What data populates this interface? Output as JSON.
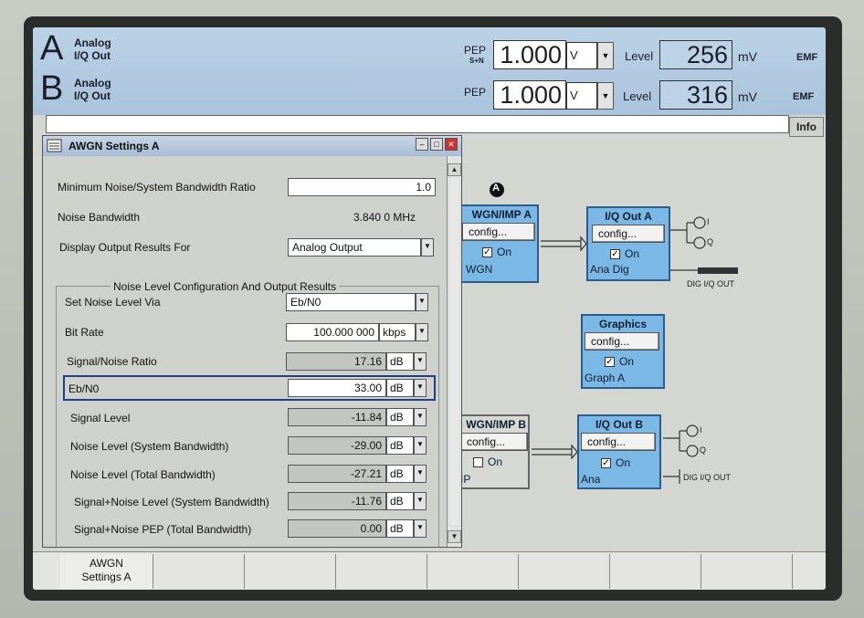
{
  "header": {
    "path_a": {
      "letter": "A",
      "line1": "Analog",
      "line2": "I/Q Out"
    },
    "path_b": {
      "letter": "B",
      "line1": "Analog",
      "line2": "I/Q Out"
    },
    "pep_a_label": "PEP",
    "pep_a_sub": "S+N",
    "pep_a_value": "1.000",
    "pep_a_unit": "V",
    "pep_b_label": "PEP",
    "pep_b_value": "1.000",
    "pep_b_unit": "V",
    "level_label": "Level",
    "level_a_value": "256",
    "level_a_unit": "mV",
    "level_b_value": "316",
    "level_b_unit": "mV",
    "emf": "EMF",
    "info_button": "Info"
  },
  "blocks": {
    "awgn_a": {
      "title": "WGN/IMP A",
      "config": "config...",
      "on_label": "On",
      "on_checked": true,
      "status": "WGN"
    },
    "iq_out_a": {
      "title": "I/Q Out A",
      "config": "config...",
      "on_label": "On",
      "on_checked": true,
      "status": "Ana Dig"
    },
    "graphics": {
      "title": "Graphics",
      "config": "config...",
      "on_label": "On",
      "on_checked": true,
      "status": "Graph A"
    },
    "awgn_b": {
      "title": "WGN/IMP B",
      "config": "config...",
      "on_label": "On",
      "on_checked": false,
      "status": "IP"
    },
    "iq_out_b": {
      "title": "I/Q Out B",
      "config": "config...",
      "on_label": "On",
      "on_checked": true,
      "status": "Ana"
    },
    "path_marker": "A",
    "i_label": "I",
    "q_label": "Q",
    "dig_iq_out": "DIG I/Q OUT"
  },
  "dialog": {
    "title": "AWGN Settings A",
    "min_bw_ratio": {
      "label": "Minimum Noise/System Bandwidth Ratio",
      "value": "1.0"
    },
    "noise_bw": {
      "label": "Noise Bandwidth",
      "value": "3.840 0 MHz"
    },
    "display_for": {
      "label": "Display Output Results For",
      "value": "Analog Output"
    },
    "group_label": "Noise Level Configuration And Output Results",
    "set_via": {
      "label": "Set Noise Level Via",
      "value": "Eb/N0"
    },
    "bit_rate": {
      "label": "Bit Rate",
      "value": "100.000 000",
      "unit": "kbps"
    },
    "snr": {
      "label": "Signal/Noise Ratio",
      "value": "17.16",
      "unit": "dB"
    },
    "ebn0": {
      "label": "Eb/N0",
      "value": "33.00",
      "unit": "dB"
    },
    "signal_level": {
      "label": "Signal Level",
      "value": "-11.84",
      "unit": "dB"
    },
    "noise_sys": {
      "label": "Noise Level (System Bandwidth)",
      "value": "-29.00",
      "unit": "dB"
    },
    "noise_total": {
      "label": "Noise Level (Total Bandwidth)",
      "value": "-27.21",
      "unit": "dB"
    },
    "sn_sys": {
      "label": "Signal+Noise Level (System Bandwidth)",
      "value": "-11.76",
      "unit": "dB"
    },
    "sn_pep": {
      "label": "Signal+Noise PEP (Total Bandwidth)",
      "value": "0.00",
      "unit": "dB"
    }
  },
  "softkeys": {
    "k1_line1": "AWGN",
    "k1_line2": "Settings A"
  }
}
